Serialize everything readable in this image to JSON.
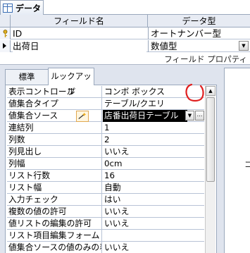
{
  "tab": {
    "label": "データ"
  },
  "grid": {
    "headers": {
      "field_name": "フィールド名",
      "data_type": "データ型"
    },
    "rows": [
      {
        "name": "ID",
        "type": "オートナンバー型"
      },
      {
        "name": "出荷日",
        "type": "数値型"
      }
    ]
  },
  "properties": {
    "title": "フィールド プロパティ",
    "tabs": [
      "標準",
      "ルックアップ"
    ],
    "rows": [
      {
        "label": "表示コントロール",
        "value": "コンボ ボックス"
      },
      {
        "label": "値集合タイプ",
        "value": "テーブル/クエリ"
      },
      {
        "label": "値集合ソース",
        "value": "店番出荷日テーブル"
      },
      {
        "label": "連結列",
        "value": "1"
      },
      {
        "label": "列数",
        "value": "2"
      },
      {
        "label": "列見出し",
        "value": "いいえ"
      },
      {
        "label": "列幅",
        "value": "0cm"
      },
      {
        "label": "リスト行数",
        "value": "16"
      },
      {
        "label": "リスト幅",
        "value": "自動"
      },
      {
        "label": "入力チェック",
        "value": "はい"
      },
      {
        "label": "複数の値の許可",
        "value": "いいえ"
      },
      {
        "label": "値リストの編集の許可",
        "value": "いいえ"
      },
      {
        "label": "リスト項目編集フォーム",
        "value": ""
      },
      {
        "label": "値集合ソースの値のみの表",
        "value": "いいえ"
      }
    ]
  },
  "side_glyph": "コ",
  "colors": {
    "annotation": "#e02020",
    "selection": "#000000",
    "header_bg": "#e7ebf3"
  }
}
